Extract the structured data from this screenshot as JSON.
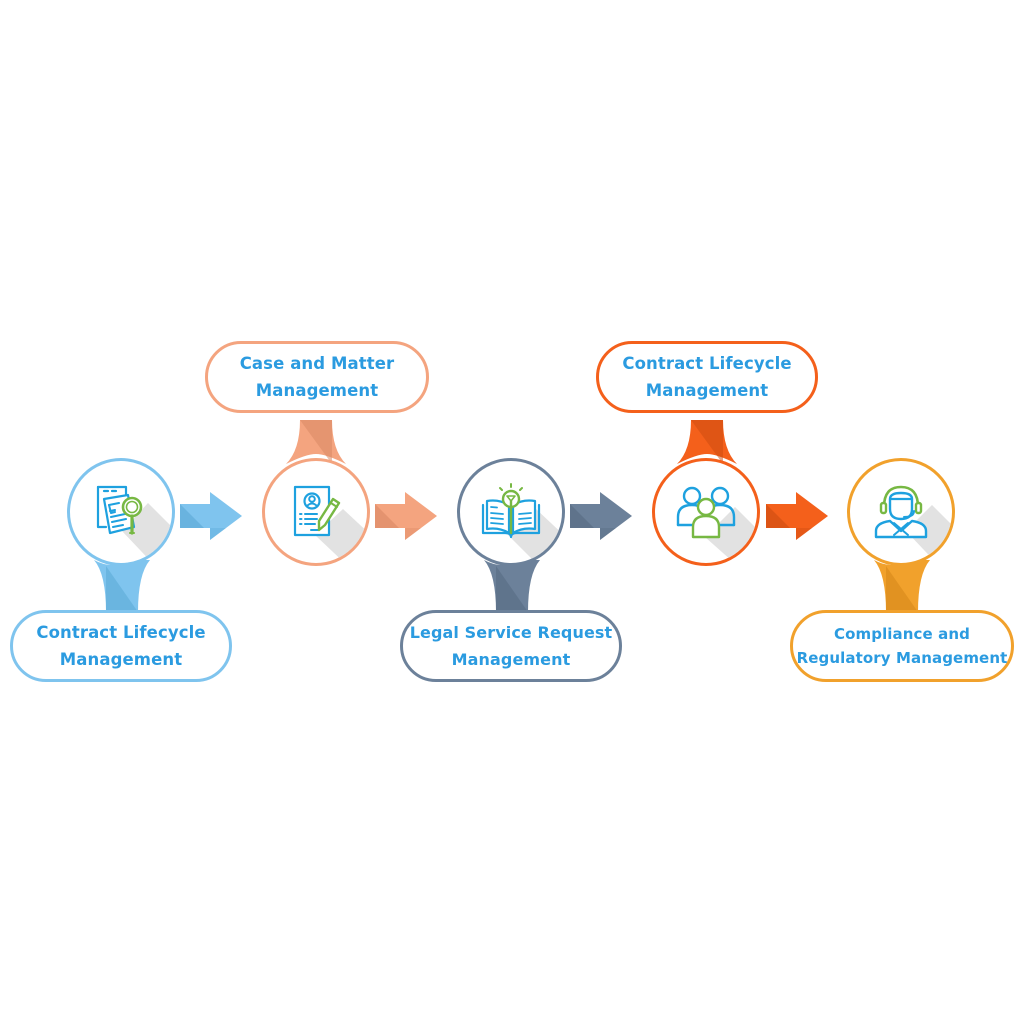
{
  "diagram": {
    "type": "process-flow",
    "direction": "left-to-right",
    "steps": [
      {
        "index": 1,
        "label_line1": "Contract Lifecycle",
        "label_line2": "Management",
        "label_position": "bottom",
        "icon": "document-search-icon",
        "color": "#7fc4ee"
      },
      {
        "index": 2,
        "label_line1": "Case and Matter",
        "label_line2": "Management",
        "label_position": "top",
        "icon": "profile-document-pencil-icon",
        "color": "#f4a47f"
      },
      {
        "index": 3,
        "label_line1": "Legal Service Request",
        "label_line2": "Management",
        "label_position": "bottom",
        "icon": "book-lightbulb-icon",
        "color": "#6c819a"
      },
      {
        "index": 4,
        "label_line1": "Contract Lifecycle",
        "label_line2": "Management",
        "label_position": "top",
        "icon": "team-group-icon",
        "color": "#f4601b"
      },
      {
        "index": 5,
        "label_line1": "Compliance and",
        "label_line2": "Regulatory Management",
        "label_position": "bottom",
        "icon": "support-agent-headset-icon",
        "color": "#f1a12c"
      }
    ],
    "arrows": [
      {
        "from": 1,
        "to": 2,
        "color": "#7fc4ee"
      },
      {
        "from": 2,
        "to": 3,
        "color": "#f4a47f"
      },
      {
        "from": 3,
        "to": 4,
        "color": "#6c819a"
      },
      {
        "from": 4,
        "to": 5,
        "color": "#f4601b"
      }
    ],
    "text_color": "#2b9be0",
    "icon_primary_color": "#1ea1df",
    "icon_accent_color": "#77b843"
  }
}
